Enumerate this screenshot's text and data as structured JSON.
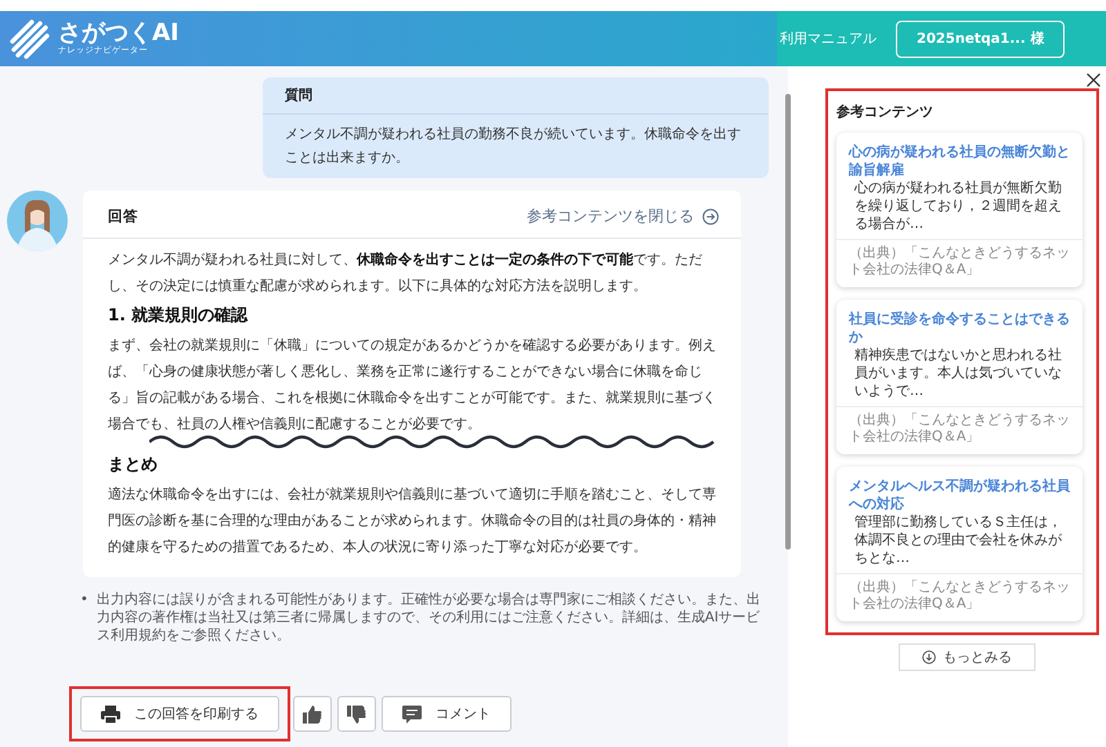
{
  "header": {
    "logo_title": "さがつくAI",
    "logo_subtitle": "ナレッジナビゲーター",
    "manual_link": "利用マニュアル",
    "user": "2025netqa1... 様"
  },
  "question": {
    "label": "質問",
    "text": "メンタル不調が疑われる社員の勤務不良が続いています。休職命令を出すことは出来ますか。"
  },
  "answer": {
    "label": "回答",
    "toggle": "参考コンテンツを閉じる",
    "blocks": [
      {
        "kind": "paragraph",
        "text": "メンタル不調が疑われる社員に対して、**休職命令を出すことは一定の条件の下で可能**です。ただし、その決定には慎重な配慮が求められます。以下に具体的な対応方法を説明します。"
      },
      {
        "kind": "heading",
        "text": "1. 就業規則の確認"
      },
      {
        "kind": "paragraph",
        "text": "まず、会社の就業規則に「休職」についての規定があるかどうかを確認する必要があります。例えば、「心身の健康状態が著しく悪化し、業務を正常に遂行することができない場合に休職を命じる」旨の記載がある場合、これを根拠に休職命令を出すことが可能です。また、就業規則に基づく場合でも、社員の人権や信義則に配慮することが必要です。"
      },
      {
        "kind": "cut"
      },
      {
        "kind": "heading",
        "text": "まとめ"
      },
      {
        "kind": "paragraph",
        "text": "適法な休職命令を出すには、会社が就業規則や信義則に基づいて適切に手順を踏むこと、そして専門医の診断を基に合理的な理由があることが求められます。休職命令の目的は社員の身体的・精神的健康を守るための措置であるため、本人の状況に寄り添った丁寧な対応が必要です。"
      }
    ]
  },
  "disclaimer": {
    "marker": "•",
    "text": "出力内容には誤りが含まれる可能性があります。正確性が必要な場合は専門家にご相談ください。また、出力内容の著作権は当社又は第三者に帰属しますので、その利用にはご注意ください。詳細は、生成AIサービス利用規約をご参照ください。"
  },
  "actions": [
    {
      "kind": "print",
      "label": "この回答を印刷する",
      "highlighted": true
    },
    {
      "kind": "like",
      "highlighted": false
    },
    {
      "kind": "dislike",
      "highlighted": false
    },
    {
      "kind": "comment",
      "label": "コメント",
      "highlighted": false
    }
  ],
  "references": {
    "title": "参考コンテンツ",
    "highlighted": true,
    "items": [
      {
        "title": "心の病が疑われる社員の無断欠勤と諭旨解雇",
        "summary": "心の病が疑われる社員が無断欠勤を繰り返しており，２週間を超える場合が…",
        "source": "（出典）「こんなときどうするネット会社の法律Q＆A」"
      },
      {
        "title": "社員に受診を命令することはできるか",
        "summary": "精神疾患ではないかと思われる社員がいます。本人は気づいていないようで…",
        "source": "（出典）「こんなときどうするネット会社の法律Q＆A」"
      },
      {
        "title": "メンタルヘルス不調が疑われる社員への対応",
        "summary": "管理部に勤務しているＳ主任は，体調不良との理由で会社を休みがちとな…",
        "source": "（出典）「こんなときどうするネット会社の法律Q＆A」"
      }
    ],
    "more": "もっとみる"
  }
}
